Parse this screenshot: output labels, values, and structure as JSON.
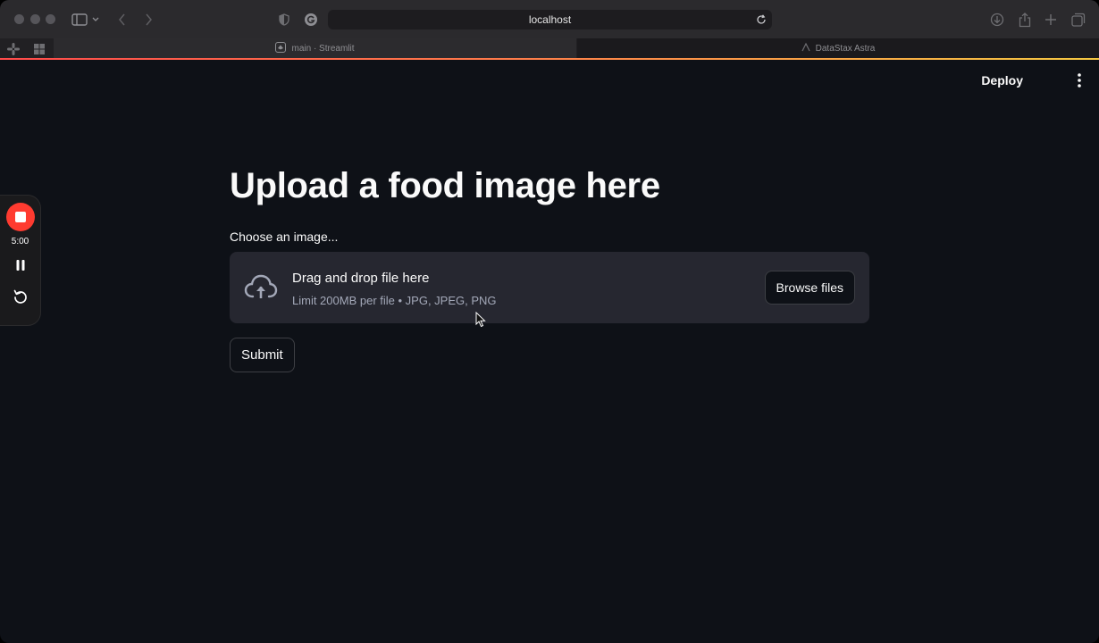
{
  "browser": {
    "address": "localhost",
    "tabs": [
      {
        "label": "main · Streamlit",
        "active": true
      },
      {
        "label": "DataStax Astra",
        "active": false
      }
    ],
    "accent_colors": [
      "#ff4b4b",
      "#f5c842"
    ]
  },
  "header": {
    "deploy_label": "Deploy"
  },
  "main": {
    "title": "Upload a food image here",
    "uploader": {
      "label": "Choose an image...",
      "dropzone_text": "Drag and drop file here",
      "limit_text": "Limit 200MB per file • JPG, JPEG, PNG",
      "browse_label": "Browse files"
    },
    "submit_label": "Submit"
  },
  "recorder": {
    "time": "5:00",
    "stop_color": "#ff3b30"
  },
  "theme": {
    "background": "#0e1117",
    "surface": "#262730",
    "text": "#fafafa",
    "muted_text": "#a3a8b8"
  }
}
